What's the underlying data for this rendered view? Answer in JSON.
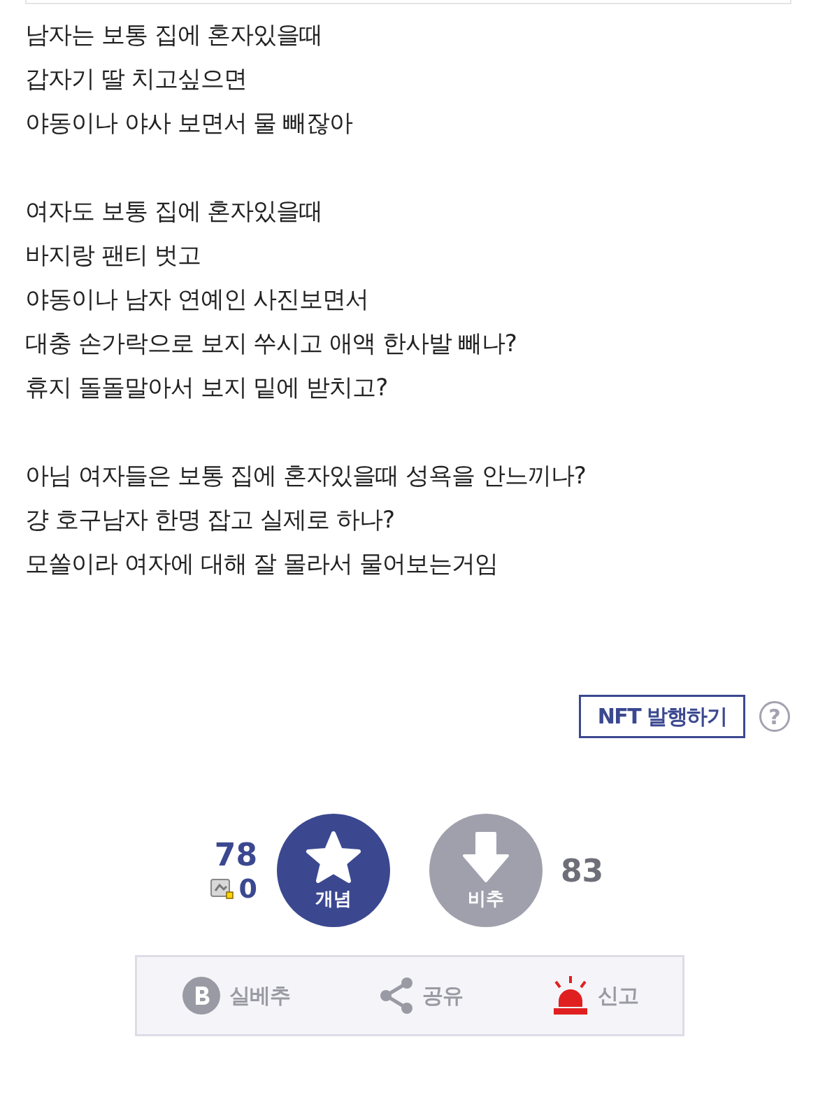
{
  "post_body": {
    "paragraphs": [
      [
        "남자는 보통 집에 혼자있을때",
        "갑자기 딸 치고싶으면",
        "야동이나 야사 보면서 물 빼잖아"
      ],
      [
        "여자도 보통 집에 혼자있을때",
        "바지랑 팬티 벗고",
        "야동이나 남자 연예인 사진보면서",
        "대충 손가락으로 보지 쑤시고 애액 한사발 빼나?",
        "휴지 돌돌말아서 보지 밑에 받치고?"
      ],
      [
        "아님 여자들은 보통 집에 혼자있을때 성욕을 안느끼나?",
        "걍 호구남자 한명 잡고 실제로 하나?",
        "모쏠이라 여자에 대해 잘 몰라서 물어보는거임"
      ]
    ]
  },
  "nft_button": {
    "label": "NFT 발행하기",
    "help": "?"
  },
  "votes": {
    "up_count": "78",
    "fixed_count": "0",
    "up_label": "개념",
    "down_label": "비추",
    "down_count": "83"
  },
  "actions": [
    {
      "kind": "best",
      "label": "실베추"
    },
    {
      "kind": "share",
      "label": "공유"
    },
    {
      "kind": "report",
      "label": "신고"
    }
  ]
}
